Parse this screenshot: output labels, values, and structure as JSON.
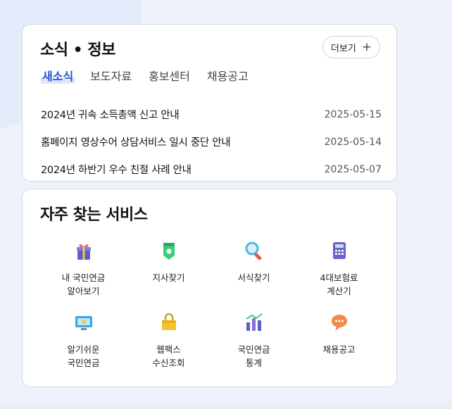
{
  "news": {
    "title": "소식 • 정보",
    "more_label": "더보기",
    "tabs": [
      {
        "label": "새소식",
        "active": true
      },
      {
        "label": "보도자료",
        "active": false
      },
      {
        "label": "홍보센터",
        "active": false
      },
      {
        "label": "채용공고",
        "active": false
      }
    ],
    "items": [
      {
        "title": "2024년 귀속 소득총액 신고 안내",
        "date": "2025-05-15"
      },
      {
        "title": "홈페이지 영상수어 상담서비스 일시 중단 안내",
        "date": "2025-05-14"
      },
      {
        "title": "2024년 하반기 우수 친절 사례 안내",
        "date": "2025-05-07"
      }
    ]
  },
  "services": {
    "title": "자주 찾는 서비스",
    "items": [
      {
        "label": "내 국민연금\n알아보기",
        "icon": "gift-icon"
      },
      {
        "label": "지사찾기",
        "icon": "location-badge-icon"
      },
      {
        "label": "서식찾기",
        "icon": "magnifier-icon"
      },
      {
        "label": "4대보험료\n계산기",
        "icon": "calculator-icon"
      },
      {
        "label": "알기쉬운\n국민연금",
        "icon": "monitor-icon"
      },
      {
        "label": "웹팩스\n수신조회",
        "icon": "lock-folder-icon"
      },
      {
        "label": "국민연금\n통계",
        "icon": "bar-chart-icon"
      },
      {
        "label": "채용공고",
        "icon": "speech-bubble-icon"
      }
    ]
  },
  "colors": {
    "accent": "#2553c9",
    "border": "#d4d8e0",
    "background": "#eef2fb"
  }
}
